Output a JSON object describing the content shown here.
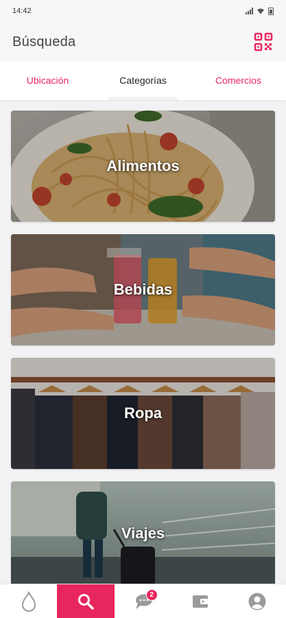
{
  "status_bar": {
    "time": "14:42"
  },
  "header": {
    "title": "Búsqueda",
    "qr_icon": "qr-code-icon",
    "accent": "#e8265e"
  },
  "tabs": [
    {
      "label": "Ubicación",
      "active": false
    },
    {
      "label": "Categorías",
      "active": true
    },
    {
      "label": "Comercios",
      "active": false
    }
  ],
  "categories": [
    {
      "label": "Alimentos",
      "image": "pasta-dish-photo"
    },
    {
      "label": "Bebidas",
      "image": "drinks-toast-photo"
    },
    {
      "label": "Ropa",
      "image": "clothes-rack-photo"
    },
    {
      "label": "Viajes",
      "image": "traveler-luggage-photo"
    }
  ],
  "bottom_nav": {
    "items": [
      {
        "icon": "home-drop-icon",
        "active": false
      },
      {
        "icon": "search-icon",
        "active": true
      },
      {
        "icon": "chat-icon",
        "active": false,
        "badge": "2"
      },
      {
        "icon": "wallet-icon",
        "active": false
      },
      {
        "icon": "profile-icon",
        "active": false
      }
    ]
  }
}
